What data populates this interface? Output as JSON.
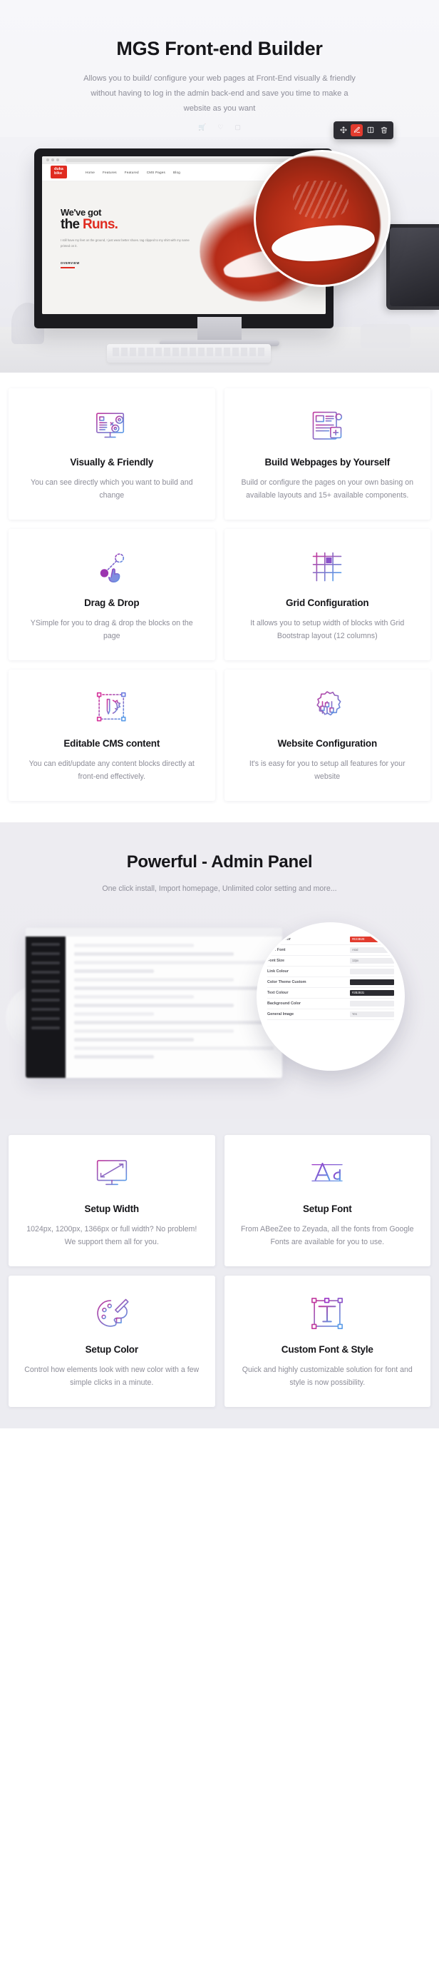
{
  "hero": {
    "title": "MGS Front-end Builder",
    "subtitle": "Allows you to build/ configure your web pages at Front-End visually & friendly without having to log in the admin back-end and save you time to make a website as you want",
    "mini_icons": [
      "cart-icon",
      "heart-icon",
      "user-icon"
    ],
    "toolbar": {
      "buttons": [
        {
          "name": "move-icon",
          "glyph": "move",
          "active": false
        },
        {
          "name": "edit-icon",
          "glyph": "edit",
          "active": true
        },
        {
          "name": "columns-icon",
          "glyph": "columns",
          "active": false
        },
        {
          "name": "trash-icon",
          "glyph": "trash",
          "active": false
        }
      ]
    },
    "site_mock": {
      "brand": "duka\\nbike",
      "nav_links": [
        "Home",
        "Features",
        "Featured",
        "CMS Pages",
        "Blog"
      ],
      "headline_line1": "We've got",
      "headline_line2_plain": "the ",
      "headline_line2_accent": "Runs.",
      "body": "I still have my feet on the ground, I just wear better shoes. tag clipped to my shirt with my name printed on it.",
      "cta": "OVERVIEW",
      "accent_color": "#e02b20"
    }
  },
  "features": {
    "left": [
      {
        "icon": "screen-settings-icon",
        "title": "Visually & Friendly",
        "text": "You can see directly which you want to build and change"
      },
      {
        "icon": "drag-drop-icon",
        "title": "Drag & Drop",
        "text": "YSimple for you to drag & drop the blocks on the page"
      },
      {
        "icon": "editable-cms-icon",
        "title": "Editable CMS content",
        "text": "You can edit/update any content blocks directly at front-end effectively."
      }
    ],
    "right": [
      {
        "icon": "webpage-builder-icon",
        "title": "Build Webpages by Yourself",
        "text": "Build or configure the pages on your own basing on available layouts and 15+ available components."
      },
      {
        "icon": "grid-icon",
        "title": "Grid Configuration",
        "text": "It allows you to setup width of blocks with Grid Bootstrap layout (12 columns)"
      },
      {
        "icon": "gear-sliders-icon",
        "title": "Website Configuration",
        "text": "It's is easy for you to setup all features for your website"
      }
    ]
  },
  "admin": {
    "title": "Powerful - Admin Panel",
    "subtitle": "One click install, Import homepage, Unlimited color setting and more...",
    "settings_rows": [
      {
        "label": "Theme Color",
        "value": "#E23B2E",
        "style": "red"
      },
      {
        "label": "Main Font",
        "value": "Arial",
        "style": "plain"
      },
      {
        "label": "Font Size",
        "value": "12px",
        "style": "plain"
      },
      {
        "label": "Link Colour",
        "value": "",
        "style": "light"
      },
      {
        "label": "Color Theme Custom",
        "value": "",
        "style": "dark"
      },
      {
        "label": "Text Colour",
        "value": "#2B2B31",
        "style": "dark"
      },
      {
        "label": "Background Color",
        "value": "",
        "style": "light"
      },
      {
        "label": "General Image",
        "value": "Yes",
        "style": "plain"
      }
    ]
  },
  "setup_cards": [
    {
      "icon": "monitor-width-icon",
      "title": "Setup Width",
      "text": "1024px, 1200px, 1366px or full width? No problem! We support them all for you."
    },
    {
      "icon": "font-aa-icon",
      "title": "Setup Font",
      "text": "From ABeeZee to Zeyada, all the fonts from Google Fonts are available for you to use."
    },
    {
      "icon": "color-palette-icon",
      "title": "Setup Color",
      "text": "Control how elements look with new color with a few simple clicks in a minute."
    },
    {
      "icon": "custom-type-icon",
      "title": "Custom Font & Style",
      "text": "Quick and highly customizable solution for font and style is now possibility."
    }
  ],
  "theme": {
    "gradient_start": "#c0389e",
    "gradient_mid": "#9b4fd0",
    "gradient_end": "#5b9ce8",
    "accent_red": "#e23b2e",
    "heading": "#16161a",
    "body_text": "#8d8d98"
  }
}
